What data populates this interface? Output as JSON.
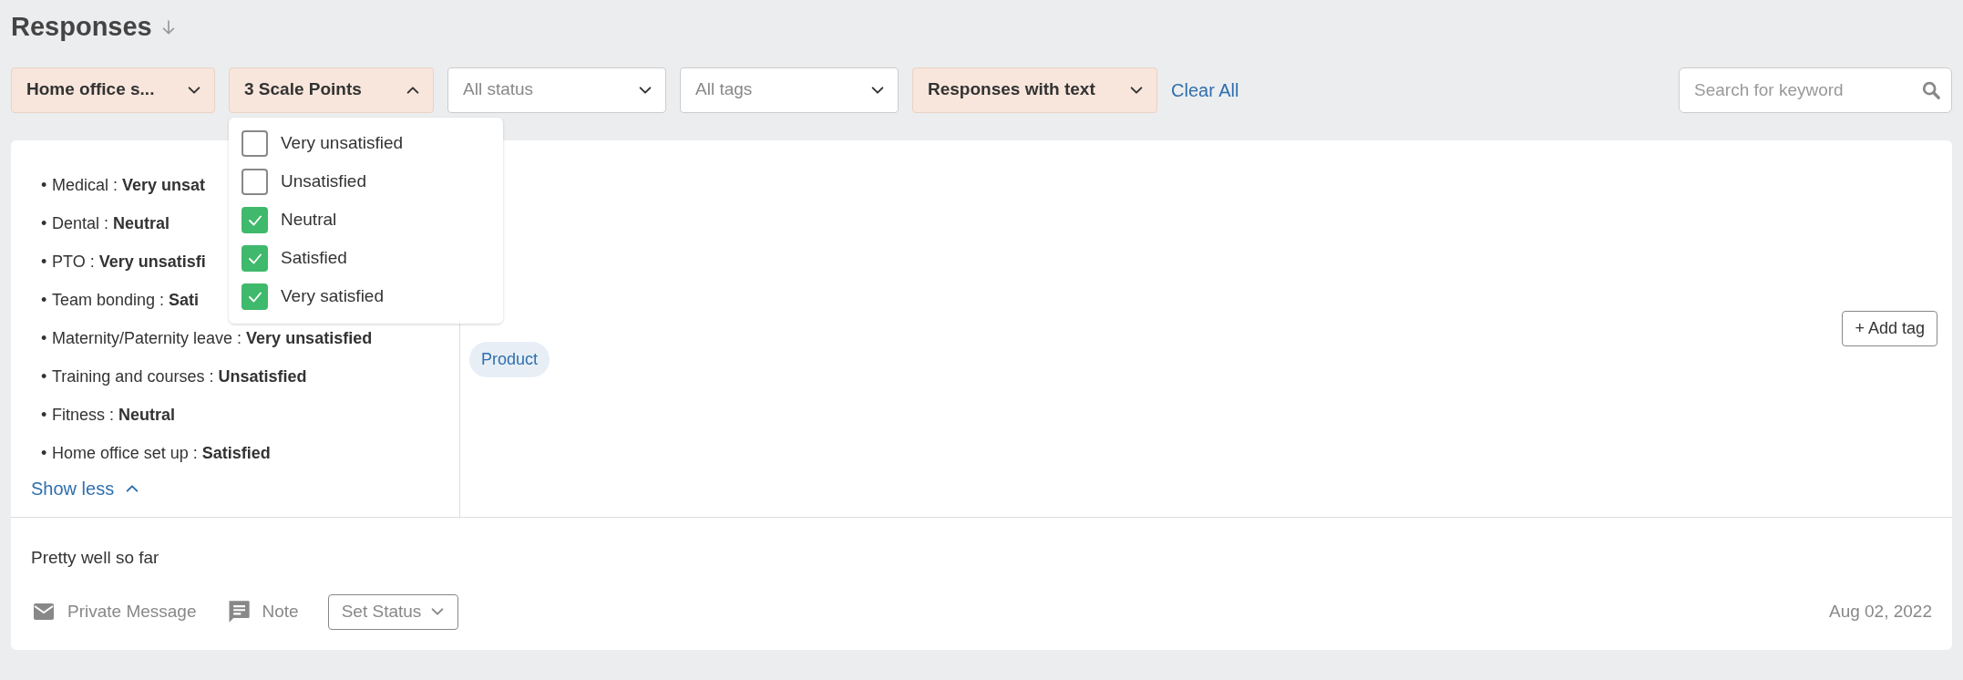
{
  "header": {
    "title": "Responses"
  },
  "filters": [
    {
      "kind": "chip",
      "label": "Home office s...",
      "expanded": false
    },
    {
      "kind": "chip",
      "label": "3 Scale Points",
      "expanded": true
    },
    {
      "kind": "select",
      "placeholder": "All status"
    },
    {
      "kind": "select",
      "placeholder": "All tags"
    },
    {
      "kind": "chip",
      "label": "Responses with text",
      "expanded": false
    }
  ],
  "clear_all": "Clear All",
  "search": {
    "placeholder": "Search for keyword"
  },
  "scale_menu": {
    "options": [
      {
        "label": "Very unsatisfied",
        "checked": false
      },
      {
        "label": "Unsatisfied",
        "checked": false
      },
      {
        "label": "Neutral",
        "checked": true
      },
      {
        "label": "Satisfied",
        "checked": true
      },
      {
        "label": "Very satisfied",
        "checked": true
      }
    ]
  },
  "response": {
    "answers": [
      {
        "bullet": "•",
        "text": "Medical : **Very unsat**"
      },
      {
        "bullet": "•",
        "text": "Dental : **Neutral**"
      },
      {
        "bullet": "•",
        "text": "PTO : **Very unsatisfi**"
      },
      {
        "bullet": "•",
        "text": "Team bonding : **Sati**"
      },
      {
        "bullet": "•",
        "text": "Maternity/Paternity leave : **Very unsatisfied**"
      },
      {
        "bullet": "•",
        "text": "Training and courses : **Unsatisfied**"
      },
      {
        "bullet": "•",
        "text": "Fitness : **Neutral**"
      },
      {
        "bullet": "•",
        "text": "Home office set up : **Satisfied**"
      }
    ],
    "show_less": "Show less",
    "tags": [
      "Product"
    ],
    "add_tag": "+ Add tag",
    "text": "Pretty well so far",
    "actions": [
      {
        "kind": "message",
        "label": "Private Message"
      },
      {
        "kind": "note",
        "label": "Note"
      }
    ],
    "set_status": "Set Status",
    "date": "Aug 02, 2022"
  }
}
